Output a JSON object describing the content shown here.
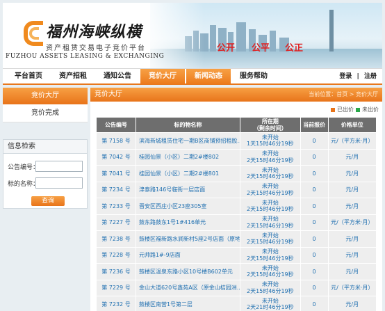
{
  "banner": {
    "brand_cn": "福州海峡纵横",
    "brand_sub": "资产租赁交易电子竞价平台",
    "brand_en": "FUZHOU ASSETS LEASING & EXCHANGING",
    "slogans": [
      "公开",
      "公平",
      "公正"
    ]
  },
  "nav": {
    "items": [
      {
        "label": "平台首页",
        "active": false
      },
      {
        "label": "资产招租",
        "active": false
      },
      {
        "label": "通知公告",
        "active": false
      },
      {
        "label": "竞价大厅",
        "active": true
      },
      {
        "label": "新闻动态",
        "active": true
      },
      {
        "label": "服务帮助",
        "active": false
      }
    ],
    "login": "登录",
    "separator": "|",
    "register": "注册"
  },
  "sidebar": {
    "active_item": "竞价大厅",
    "item2": "竞价完成",
    "search_title": "信息检索",
    "code_label": "公告编号：",
    "name_label": "标的名称：",
    "search_button": "查询"
  },
  "main": {
    "title": "竞价大厅",
    "breadcrumb": "当前位置：首页 > 竞价大厅",
    "legend": [
      {
        "label": "已出价",
        "color": "#e8741a"
      },
      {
        "label": "未出价",
        "color": "#2aa84a"
      }
    ],
    "columns": [
      "公告编号",
      "标的物名称",
      "所在期\n（剩余时间）",
      "当前报价",
      "价格单位"
    ],
    "rows": [
      {
        "num": "第 7158 号",
        "name": "滨海新城租赁住宅一期B区商铺预招租股...",
        "status": "未开始",
        "time": "1天15时46分19秒",
        "bid": "0",
        "unit": "元/（平方米·月）"
      },
      {
        "num": "第 7042 号",
        "name": "桂园仙景（小区）二期2#楼802",
        "status": "未开始",
        "time": "2天15时46分19秒",
        "bid": "0",
        "unit": "元/月"
      },
      {
        "num": "第 7041 号",
        "name": "桂园仙景（小区）二期2#楼801",
        "status": "未开始",
        "time": "2天15时46分19秒",
        "bid": "0",
        "unit": "元/月"
      },
      {
        "num": "第 7234 号",
        "name": "津泰路146号临街一层店面",
        "status": "未开始",
        "time": "2天15时46分19秒",
        "bid": "0",
        "unit": "元/月"
      },
      {
        "num": "第 7233 号",
        "name": "晋安区西庄小区23座305室",
        "status": "未开始",
        "time": "2天15时46分19秒",
        "bid": "0",
        "unit": "元/月"
      },
      {
        "num": "第 7227 号",
        "name": "鼓东路鼓东1号1#416单元",
        "status": "未开始",
        "time": "2天15时46分19秒",
        "bid": "0",
        "unit": "元/（平方米·月）"
      },
      {
        "num": "第 7238 号",
        "name": "鼓楼区福新路水涧新村5座2号店面（原地...",
        "status": "未开始",
        "time": "2天15时46分19秒",
        "bid": "0",
        "unit": "元/月"
      },
      {
        "num": "第 7228 号",
        "name": "元帅路1#-9店面",
        "status": "未开始",
        "time": "2天15时46分19秒",
        "bid": "0",
        "unit": "元/月"
      },
      {
        "num": "第 7236 号",
        "name": "鼓楼区温泉东路小区10号楼B602单元",
        "status": "未开始",
        "time": "2天15时46分19秒",
        "bid": "0",
        "unit": "元/月"
      },
      {
        "num": "第 7229 号",
        "name": "金山大道620号鑫苑A区（原金山桔园洲...",
        "status": "未开始",
        "time": "2天15时46分19秒",
        "bid": "0",
        "unit": "元/（平方米·月）"
      },
      {
        "num": "第 7232 号",
        "name": "鼓楼区南营1号第二层",
        "status": "未开始",
        "time": "2天21时46分19秒",
        "bid": "0",
        "unit": "元/月"
      }
    ]
  }
}
